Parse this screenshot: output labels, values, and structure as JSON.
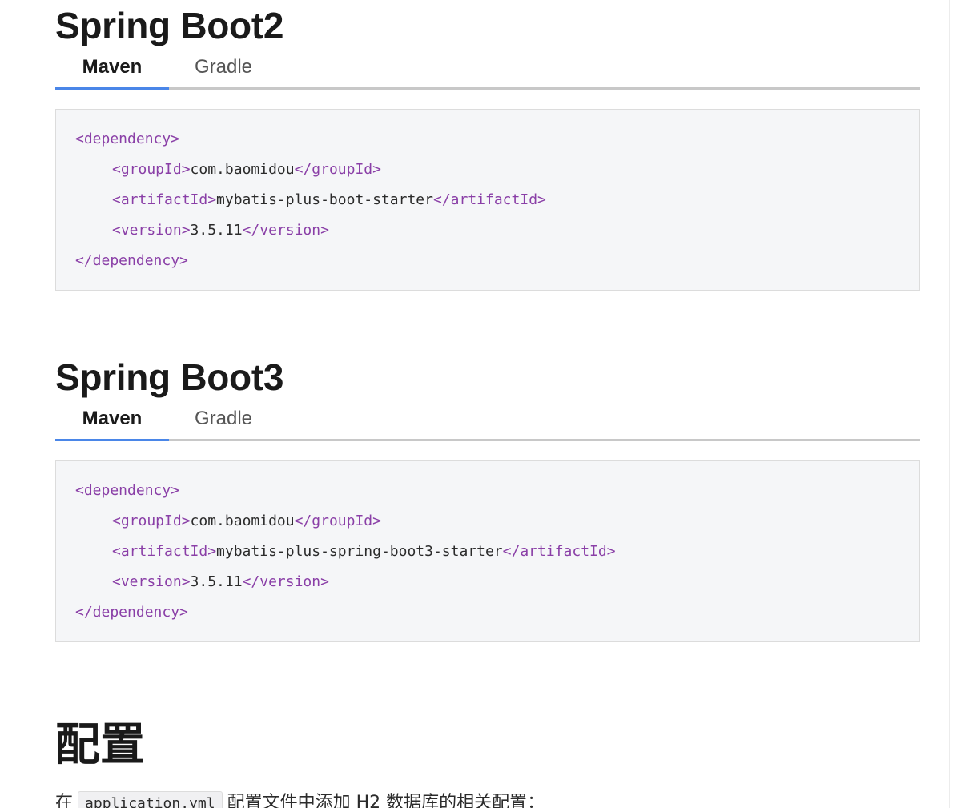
{
  "sections": [
    {
      "title": "Spring Boot2",
      "tabs": [
        {
          "label": "Maven",
          "active": true
        },
        {
          "label": "Gradle",
          "active": false
        }
      ],
      "code": {
        "open_tag": "<dependency>",
        "group_open": "<groupId>",
        "group_value": "com.baomidou",
        "group_close": "</groupId>",
        "artifact_open": "<artifactId>",
        "artifact_value": "mybatis-plus-boot-starter",
        "artifact_close": "</artifactId>",
        "version_open": "<version>",
        "version_value": "3.5.11",
        "version_close": "</version>",
        "close_tag": "</dependency>"
      }
    },
    {
      "title": "Spring Boot3",
      "tabs": [
        {
          "label": "Maven",
          "active": true
        },
        {
          "label": "Gradle",
          "active": false
        }
      ],
      "code": {
        "open_tag": "<dependency>",
        "group_open": "<groupId>",
        "group_value": "com.baomidou",
        "group_close": "</groupId>",
        "artifact_open": "<artifactId>",
        "artifact_value": "mybatis-plus-spring-boot3-starter",
        "artifact_close": "</artifactId>",
        "version_open": "<version>",
        "version_value": "3.5.11",
        "version_close": "</version>",
        "close_tag": "</dependency>"
      }
    }
  ],
  "config": {
    "title": "配置",
    "para_prefix": "在",
    "para_code": "application.yml",
    "para_suffix": "配置文件中添加 H2 数据库的相关配置："
  },
  "colors": {
    "tag": "#8a3fa7",
    "tab_accent": "#4a86e8",
    "code_bg": "#f5f6f8"
  }
}
